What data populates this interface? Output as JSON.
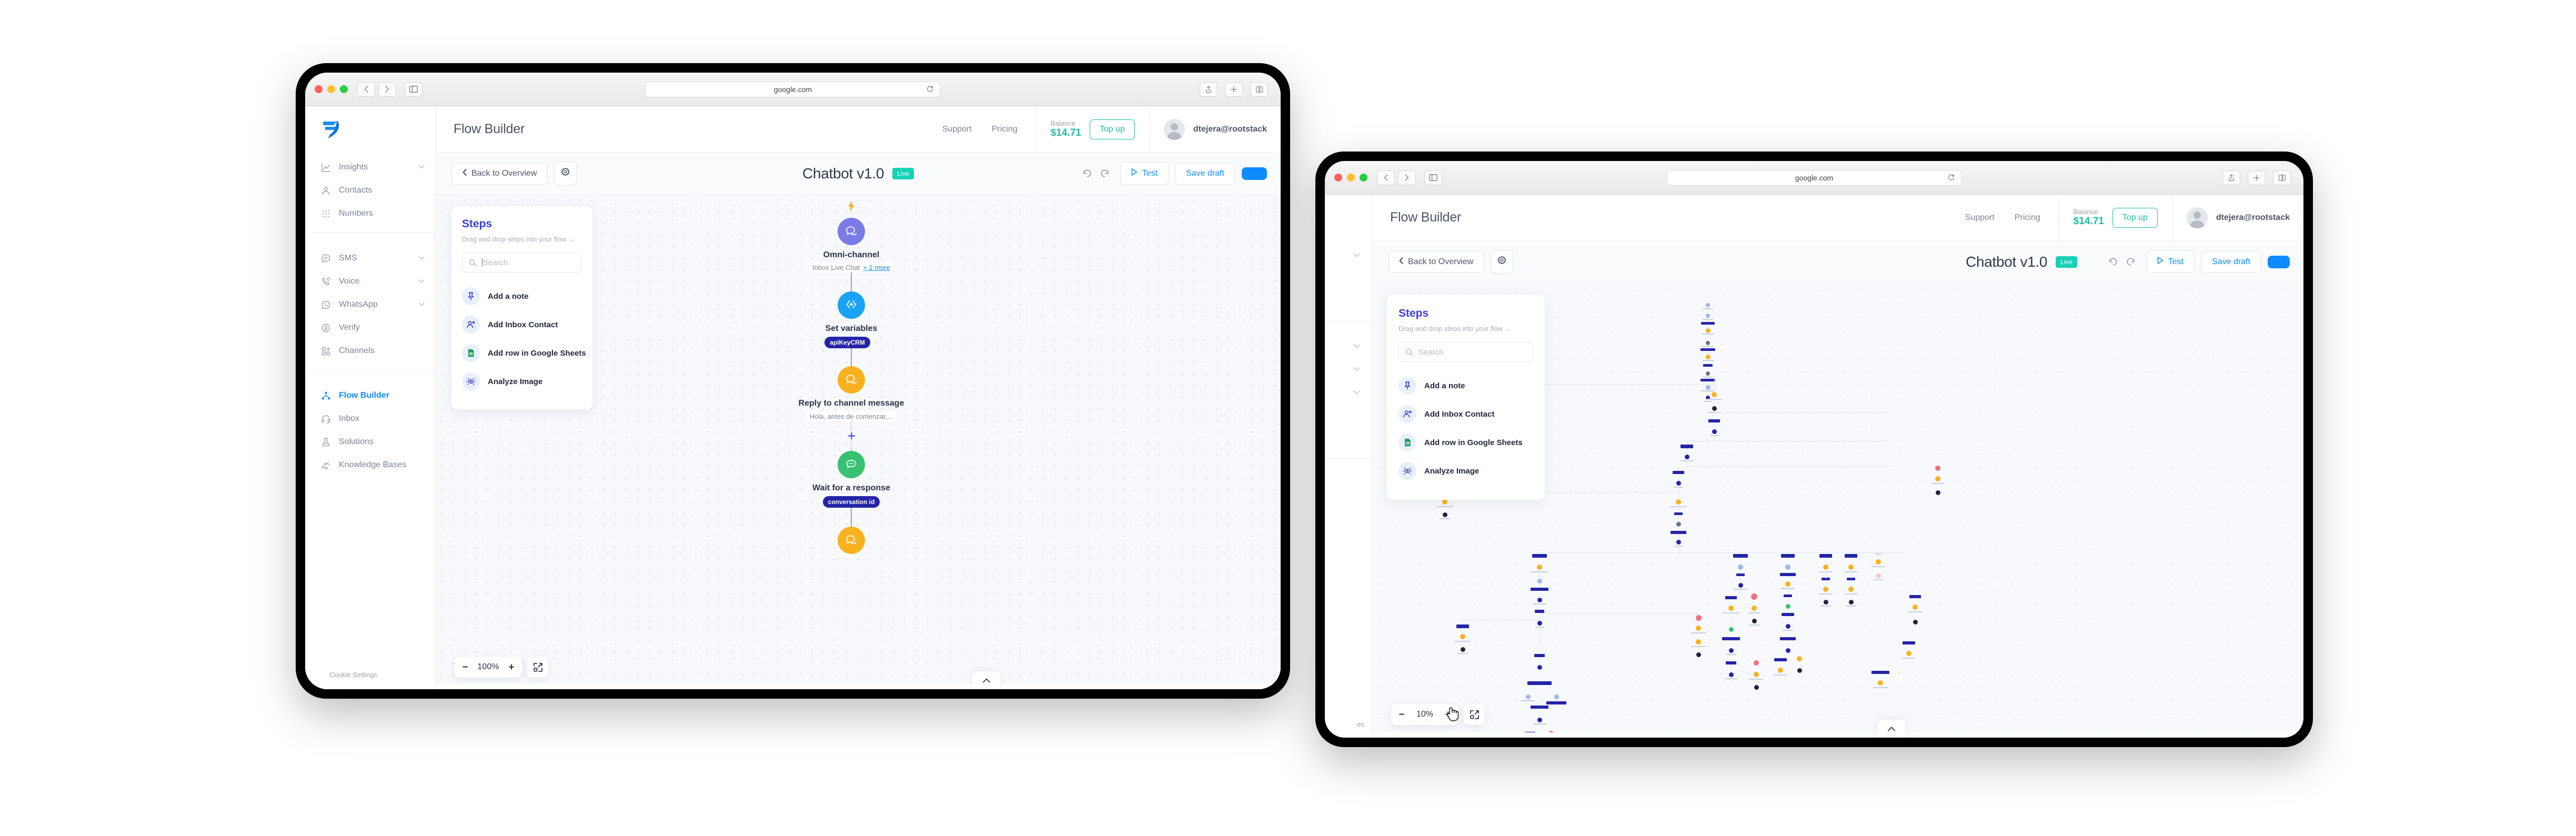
{
  "browser": {
    "url": "google.com",
    "reload_icon": "reload-icon",
    "back_icon": "chevron-left-icon",
    "forward_icon": "chevron-right-icon",
    "sidebar_toggle_icon": "sidebar-toggle-icon",
    "share_icon": "share-icon",
    "tabs_icon": "new-tab-icon",
    "overview_icon": "tab-overview-icon"
  },
  "sidebar": {
    "logo": "wavy-logo-icon",
    "groups": [
      {
        "items": [
          {
            "label": "Insights",
            "icon": "chart-line-icon",
            "chevron": true,
            "active": false
          },
          {
            "label": "Contacts",
            "icon": "user-icon",
            "chevron": false,
            "active": false
          },
          {
            "label": "Numbers",
            "icon": "dots-grid-icon",
            "chevron": false,
            "active": false
          }
        ]
      },
      {
        "items": [
          {
            "label": "SMS",
            "icon": "chat-bubble-icon",
            "chevron": true,
            "active": false
          },
          {
            "label": "Voice",
            "icon": "phone-icon",
            "chevron": true,
            "active": false
          },
          {
            "label": "WhatsApp",
            "icon": "whatsapp-icon",
            "chevron": true,
            "active": false
          },
          {
            "label": "Verify",
            "icon": "verify-shield-icon",
            "chevron": false,
            "active": false
          },
          {
            "label": "Channels",
            "icon": "channels-grid-icon",
            "chevron": false,
            "active": false
          }
        ]
      },
      {
        "items": [
          {
            "label": "Flow Builder",
            "icon": "flow-nodes-icon",
            "chevron": false,
            "active": true
          },
          {
            "label": "Inbox",
            "icon": "headset-icon",
            "chevron": false,
            "active": false
          },
          {
            "label": "Solutions",
            "icon": "flask-icon",
            "chevron": false,
            "active": false
          },
          {
            "label": "Knowledge Bases",
            "icon": "knowledge-icon",
            "chevron": false,
            "active": false
          }
        ]
      }
    ],
    "cookie_settings": "Cookie Settings"
  },
  "header": {
    "title": "Flow Builder",
    "links": [
      {
        "label": "Support"
      },
      {
        "label": "Pricing"
      }
    ],
    "balance_label": "Balance",
    "balance_amount": "$14.71",
    "topup_label": "Top up",
    "account_email": "dtejera@rootstack",
    "avatar_icon": "avatar-icon"
  },
  "toolbar": {
    "back_label": "Back to Overview",
    "back_icon": "chevron-left-icon",
    "settings_icon": "gear-icon",
    "flow_title": "Chatbot v1.0",
    "status_badge": "Live",
    "undo_icon": "undo-icon",
    "redo_icon": "redo-icon",
    "test_label": "Test",
    "test_icon": "play-icon",
    "save_label": "Save draft",
    "publish_label": ""
  },
  "steps_panel": {
    "title": "Steps",
    "subtitle": "Drag and drop steps into your flow →",
    "search_placeholder": "Search",
    "search_value": "",
    "search_icon": "search-icon",
    "items": [
      {
        "label": "Add a note",
        "icon": "pin-icon",
        "color": "#2a2fc4"
      },
      {
        "label": "Add Inbox Contact",
        "icon": "user-plus-icon",
        "color": "#2a2fc4"
      },
      {
        "label": "Add row in Google Sheets",
        "icon": "google-sheets-icon",
        "color": "#1da462"
      },
      {
        "label": "Analyze Image",
        "icon": "eye-scan-icon",
        "color": "#2a2fc4"
      }
    ]
  },
  "flow": {
    "trigger_icon": "lightning-bolt-icon",
    "nodes": [
      {
        "title": "Omni-channel",
        "icon": "omni-chat-icon",
        "color": "#7a7ae8",
        "subtitle": "Inbox Live Chat",
        "more": "+ 2 more",
        "chip": ""
      },
      {
        "title": "Set variables",
        "icon": "braces-icon",
        "color": "#1aa3f5",
        "subtitle": "",
        "chip": "apiKeyCRM",
        "chip_more": "..."
      },
      {
        "title": "Reply to channel message",
        "icon": "reply-chat-icon",
        "color": "#f9b21f",
        "subtitle": "Hola, antes de comenzar,...",
        "chip": ""
      },
      {
        "title": "Wait for a response",
        "icon": "wait-chat-icon",
        "color": "#38c172",
        "subtitle": "",
        "chip": "conversation id"
      },
      {
        "title": "",
        "icon": "reply-chat-icon",
        "color": "#f9b21f",
        "subtitle": "",
        "chip": ""
      }
    ],
    "add_node_icon": "plus-icon"
  },
  "zoom_controls_w1": {
    "minus": "−",
    "value": "100%",
    "plus": "+",
    "fit_icon": "fit-to-screen-icon"
  },
  "zoom_controls_w2": {
    "minus": "−",
    "value": "10%",
    "plus": "+",
    "fit_icon": "fit-to-screen-icon"
  },
  "bottom_tab": {
    "icon": "chevron-up-icon"
  },
  "window2": {
    "cursor": "hand-pointer-cursor",
    "canvas_note": "zoomed-out flow overview"
  },
  "colors": {
    "accent_blue": "#0f8bfd",
    "steps_indigo": "#3b3fd8",
    "balance_green": "#18bfa0",
    "live_teal": "#18d1b4",
    "node_purple": "#7a7ae8",
    "node_blue": "#1aa3f5",
    "node_amber": "#f9b21f",
    "node_green": "#38c172",
    "chip_navy": "#2424a8",
    "canvas_bg": "#f7f9fc"
  }
}
